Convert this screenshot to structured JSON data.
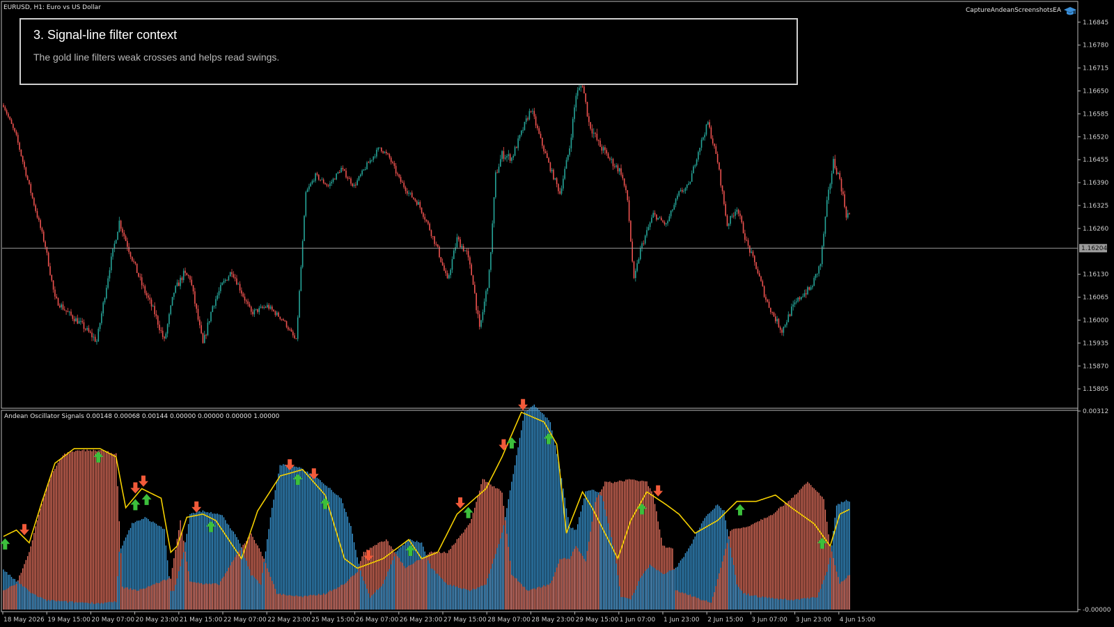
{
  "header": {
    "symbol_label": "EURUSD, H1:  Euro vs US Dollar",
    "ea_label": "CaptureAndeanScreenshotsEA",
    "ea_icon": "graduation-cap-icon"
  },
  "overlay": {
    "title": "3. Signal-line filter context",
    "subtitle": "The gold line filters weak crosses and helps read swings."
  },
  "indicator": {
    "label": "Andean Oscillator Signals 0.00148 0.00068 0.00144 0.00000 0.00000 0.00000 1.00000"
  },
  "price_axis": {
    "labels": [
      "1.16845",
      "1.16780",
      "1.16715",
      "1.16650",
      "1.16585",
      "1.16520",
      "1.16455",
      "1.16390",
      "1.16325",
      "1.16260",
      "1.16130",
      "1.16065",
      "1.16000",
      "1.15935",
      "1.15870",
      "1.15805"
    ],
    "current_price": "1.16204"
  },
  "osc_axis": {
    "labels": [
      "0.00312",
      "-0.00000"
    ]
  },
  "time_axis": {
    "labels": [
      "18 May 2026",
      "19 May 15:00",
      "20 May 07:00",
      "20 May 23:00",
      "21 May 15:00",
      "22 May 07:00",
      "22 May 23:00",
      "25 May 15:00",
      "26 May 07:00",
      "26 May 23:00",
      "27 May 15:00",
      "28 May 07:00",
      "28 May 23:00",
      "29 May 15:00",
      "1 Jun 07:00",
      "1 Jun 23:00",
      "2 Jun 15:00",
      "3 Jun 07:00",
      "3 Jun 23:00",
      "4 Jun 15:00"
    ]
  },
  "colors": {
    "bull": "#26a69a",
    "bear": "#ef5350",
    "osc_bull": "#3a9ad9",
    "osc_bear": "#e8735f",
    "signal_line": "#f5d000",
    "arrow_up": "#3cbf3c",
    "arrow_down": "#f25a3a",
    "grid_line": "#9a9a9a"
  },
  "chart_data": [
    {
      "type": "candlestick",
      "title": "EURUSD, H1:  Euro vs US Dollar",
      "ylim": [
        1.1575,
        1.169
      ],
      "current_price": 1.16204,
      "close_path": [
        [
          0,
          1.1661
        ],
        [
          8,
          1.1652
        ],
        [
          16,
          1.1638
        ],
        [
          26,
          1.1621
        ],
        [
          32,
          1.1606
        ],
        [
          40,
          1.1602
        ],
        [
          48,
          1.1599
        ],
        [
          58,
          1.1594
        ],
        [
          66,
          1.1615
        ],
        [
          72,
          1.1628
        ],
        [
          78,
          1.162
        ],
        [
          86,
          1.161
        ],
        [
          94,
          1.1602
        ],
        [
          100,
          1.1594
        ],
        [
          106,
          1.1608
        ],
        [
          112,
          1.1613
        ],
        [
          116,
          1.1612
        ],
        [
          124,
          1.1593
        ],
        [
          130,
          1.1604
        ],
        [
          136,
          1.161
        ],
        [
          142,
          1.1614
        ],
        [
          148,
          1.1608
        ],
        [
          154,
          1.1602
        ],
        [
          164,
          1.1604
        ],
        [
          174,
          1.16
        ],
        [
          182,
          1.1594
        ],
        [
          188,
          1.1636
        ],
        [
          194,
          1.1641
        ],
        [
          202,
          1.1638
        ],
        [
          210,
          1.1643
        ],
        [
          218,
          1.1638
        ],
        [
          226,
          1.1644
        ],
        [
          234,
          1.1649
        ],
        [
          240,
          1.1646
        ],
        [
          246,
          1.164
        ],
        [
          252,
          1.1636
        ],
        [
          258,
          1.1633
        ],
        [
          264,
          1.1627
        ],
        [
          270,
          1.162
        ],
        [
          276,
          1.1611
        ],
        [
          282,
          1.1623
        ],
        [
          288,
          1.1619
        ],
        [
          292,
          1.1611
        ],
        [
          296,
          1.1597
        ],
        [
          302,
          1.1613
        ],
        [
          306,
          1.1641
        ],
        [
          310,
          1.1647
        ],
        [
          316,
          1.1646
        ],
        [
          322,
          1.1653
        ],
        [
          328,
          1.166
        ],
        [
          334,
          1.1651
        ],
        [
          340,
          1.1643
        ],
        [
          346,
          1.1636
        ],
        [
          352,
          1.1649
        ],
        [
          356,
          1.1664
        ],
        [
          360,
          1.1667
        ],
        [
          364,
          1.1656
        ],
        [
          370,
          1.165
        ],
        [
          378,
          1.1645
        ],
        [
          384,
          1.1642
        ],
        [
          388,
          1.1634
        ],
        [
          392,
          1.1611
        ],
        [
          396,
          1.162
        ],
        [
          404,
          1.163
        ],
        [
          412,
          1.1627
        ],
        [
          420,
          1.1636
        ],
        [
          426,
          1.1638
        ],
        [
          432,
          1.1648
        ],
        [
          438,
          1.1656
        ],
        [
          444,
          1.1645
        ],
        [
          450,
          1.1627
        ],
        [
          456,
          1.1632
        ],
        [
          462,
          1.1622
        ],
        [
          468,
          1.1615
        ],
        [
          474,
          1.1606
        ],
        [
          478,
          1.1602
        ],
        [
          484,
          1.1597
        ],
        [
          490,
          1.1603
        ],
        [
          496,
          1.1607
        ],
        [
          502,
          1.1609
        ],
        [
          508,
          1.1616
        ],
        [
          512,
          1.1633
        ],
        [
          516,
          1.1645
        ],
        [
          520,
          1.164
        ],
        [
          524,
          1.163
        ]
      ],
      "volatility_path": [
        [
          0,
          7
        ],
        [
          40,
          12
        ],
        [
          120,
          14
        ],
        [
          180,
          8
        ],
        [
          260,
          10
        ],
        [
          300,
          16
        ],
        [
          340,
          10
        ],
        [
          370,
          16
        ],
        [
          410,
          9
        ],
        [
          470,
          12
        ],
        [
          526,
          14
        ]
      ],
      "bar_count": 527
    },
    {
      "type": "histogram",
      "title": "Andean Oscillator Signals 0.00148 0.00068 0.00144 0.00000 0.00000 0.00000 1.00000",
      "ylim": [
        0,
        0.00312
      ],
      "bull_path": [
        [
          0,
          0.00062
        ],
        [
          8,
          0.00045
        ],
        [
          18,
          0.00025
        ],
        [
          26,
          0.00015
        ],
        [
          40,
          0.00012
        ],
        [
          60,
          0.0001
        ],
        [
          70,
          0.00012
        ],
        [
          72,
          0.0009
        ],
        [
          80,
          0.00135
        ],
        [
          88,
          0.00145
        ],
        [
          100,
          0.00126
        ],
        [
          104,
          0.0003
        ],
        [
          106,
          0.00028
        ],
        [
          112,
          0.0009
        ],
        [
          116,
          0.0015
        ],
        [
          124,
          0.00155
        ],
        [
          136,
          0.00148
        ],
        [
          146,
          0.0011
        ],
        [
          154,
          0.00055
        ],
        [
          160,
          0.0004
        ],
        [
          166,
          0.00145
        ],
        [
          172,
          0.00228
        ],
        [
          182,
          0.00225
        ],
        [
          194,
          0.0021
        ],
        [
          210,
          0.00175
        ],
        [
          216,
          0.0013
        ],
        [
          222,
          0.0006
        ],
        [
          228,
          0.0002
        ],
        [
          236,
          0.0004
        ],
        [
          244,
          0.0009
        ],
        [
          252,
          0.0011
        ],
        [
          260,
          0.00105
        ],
        [
          266,
          0.00065
        ],
        [
          276,
          0.0004
        ],
        [
          290,
          0.0003
        ],
        [
          300,
          0.0004
        ],
        [
          310,
          0.0012
        ],
        [
          316,
          0.002
        ],
        [
          324,
          0.0031
        ],
        [
          330,
          0.00322
        ],
        [
          340,
          0.00295
        ],
        [
          346,
          0.0022
        ],
        [
          352,
          0.0013
        ],
        [
          356,
          0.00125
        ],
        [
          362,
          0.00185
        ],
        [
          366,
          0.00188
        ],
        [
          372,
          0.0018
        ],
        [
          380,
          0.0009
        ],
        [
          384,
          0.0002
        ],
        [
          390,
          0.00015
        ],
        [
          396,
          0.0005
        ],
        [
          402,
          0.0007
        ],
        [
          410,
          0.00055
        ],
        [
          418,
          0.00065
        ],
        [
          426,
          0.00095
        ],
        [
          436,
          0.00145
        ],
        [
          444,
          0.00165
        ],
        [
          448,
          0.00155
        ],
        [
          456,
          0.0004
        ],
        [
          460,
          0.00025
        ],
        [
          470,
          0.0002
        ],
        [
          490,
          0.00015
        ],
        [
          506,
          0.0002
        ],
        [
          512,
          0.0006
        ],
        [
          514,
          0.0008
        ],
        [
          518,
          0.00165
        ],
        [
          524,
          0.00172
        ],
        [
          528,
          0.00165
        ]
      ],
      "bear_path": [
        [
          0,
          0.0003
        ],
        [
          8,
          0.0004
        ],
        [
          16,
          0.0009
        ],
        [
          22,
          0.0015
        ],
        [
          30,
          0.00215
        ],
        [
          38,
          0.00245
        ],
        [
          48,
          0.0025
        ],
        [
          60,
          0.0025
        ],
        [
          70,
          0.00245
        ],
        [
          74,
          0.00035
        ],
        [
          84,
          0.0003
        ],
        [
          94,
          0.0004
        ],
        [
          104,
          0.0005
        ],
        [
          110,
          0.0014
        ],
        [
          116,
          0.00045
        ],
        [
          124,
          0.0004
        ],
        [
          134,
          0.0004
        ],
        [
          146,
          0.0009
        ],
        [
          154,
          0.0012
        ],
        [
          162,
          0.0008
        ],
        [
          170,
          0.00025
        ],
        [
          186,
          0.0002
        ],
        [
          200,
          0.00025
        ],
        [
          212,
          0.0004
        ],
        [
          220,
          0.0006
        ],
        [
          224,
          0.0009
        ],
        [
          230,
          0.001
        ],
        [
          238,
          0.0011
        ],
        [
          250,
          0.00065
        ],
        [
          266,
          0.0009
        ],
        [
          276,
          0.0009
        ],
        [
          290,
          0.00135
        ],
        [
          298,
          0.00205
        ],
        [
          310,
          0.00185
        ],
        [
          316,
          0.00055
        ],
        [
          326,
          0.0003
        ],
        [
          340,
          0.0004
        ],
        [
          346,
          0.0008
        ],
        [
          352,
          0.0008
        ],
        [
          356,
          0.001
        ],
        [
          362,
          0.00075
        ],
        [
          368,
          0.0017
        ],
        [
          374,
          0.002
        ],
        [
          380,
          0.002
        ],
        [
          390,
          0.00205
        ],
        [
          400,
          0.002
        ],
        [
          404,
          0.0018
        ],
        [
          410,
          0.001
        ],
        [
          416,
          0.00095
        ],
        [
          418,
          0.0003
        ],
        [
          430,
          0.0002
        ],
        [
          440,
          0.0001
        ],
        [
          448,
          0.00085
        ],
        [
          452,
          0.00125
        ],
        [
          462,
          0.0013
        ],
        [
          478,
          0.0015
        ],
        [
          490,
          0.00175
        ],
        [
          500,
          0.002
        ],
        [
          510,
          0.00175
        ],
        [
          514,
          0.001
        ],
        [
          520,
          0.0004
        ],
        [
          526,
          0.00055
        ]
      ],
      "signal_path": [
        [
          0,
          0.00115
        ],
        [
          8,
          0.00125
        ],
        [
          16,
          0.00105
        ],
        [
          24,
          0.0017
        ],
        [
          32,
          0.0023
        ],
        [
          44,
          0.00253
        ],
        [
          60,
          0.00253
        ],
        [
          70,
          0.0024
        ],
        [
          76,
          0.0016
        ],
        [
          86,
          0.0019
        ],
        [
          98,
          0.00175
        ],
        [
          104,
          0.0009
        ],
        [
          108,
          0.001
        ],
        [
          114,
          0.00145
        ],
        [
          124,
          0.0015
        ],
        [
          132,
          0.0014
        ],
        [
          140,
          0.0011
        ],
        [
          148,
          0.0008
        ],
        [
          158,
          0.00155
        ],
        [
          172,
          0.0021
        ],
        [
          186,
          0.0022
        ],
        [
          200,
          0.0018
        ],
        [
          212,
          0.0008
        ],
        [
          220,
          0.00065
        ],
        [
          236,
          0.0008
        ],
        [
          252,
          0.0011
        ],
        [
          260,
          0.0008
        ],
        [
          270,
          0.0009
        ],
        [
          282,
          0.0015
        ],
        [
          300,
          0.0019
        ],
        [
          310,
          0.0024
        ],
        [
          322,
          0.0031
        ],
        [
          336,
          0.00295
        ],
        [
          344,
          0.0026
        ],
        [
          350,
          0.0012
        ],
        [
          360,
          0.00185
        ],
        [
          366,
          0.0016
        ],
        [
          372,
          0.0013
        ],
        [
          382,
          0.0008
        ],
        [
          390,
          0.0014
        ],
        [
          400,
          0.00185
        ],
        [
          412,
          0.00165
        ],
        [
          420,
          0.0015
        ],
        [
          430,
          0.0012
        ],
        [
          444,
          0.0014
        ],
        [
          456,
          0.0017
        ],
        [
          468,
          0.0017
        ],
        [
          480,
          0.0018
        ],
        [
          490,
          0.0016
        ],
        [
          504,
          0.00135
        ],
        [
          514,
          0.001
        ],
        [
          520,
          0.0015
        ],
        [
          528,
          0.0016
        ]
      ],
      "arrows_up": [
        1,
        59,
        82,
        89,
        129,
        183,
        200,
        253,
        289,
        316,
        339,
        397,
        458,
        509
      ],
      "arrows_down": [
        13,
        82,
        87,
        120,
        178,
        193,
        227,
        284,
        311,
        323,
        407
      ],
      "bar_count": 527
    }
  ]
}
